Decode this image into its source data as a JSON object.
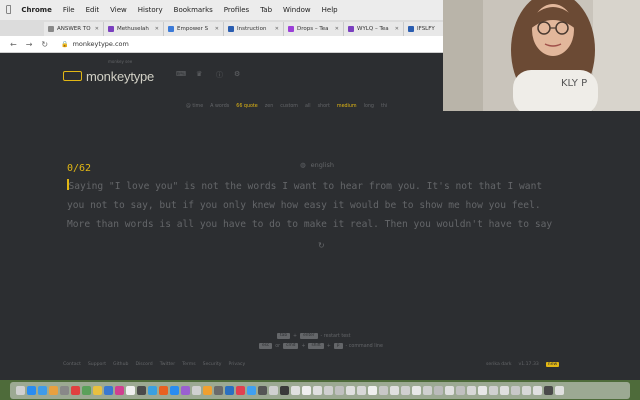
{
  "menubar": {
    "apple": "",
    "items": [
      "Chrome",
      "File",
      "Edit",
      "View",
      "History",
      "Bookmarks",
      "Profiles",
      "Tab",
      "Window",
      "Help"
    ]
  },
  "browser": {
    "tabs": [
      {
        "label": "ANSWER TO",
        "color": "#888888"
      },
      {
        "label": "Methuselah",
        "color": "#7a3fbf"
      },
      {
        "label": "Empower S",
        "color": "#3b7ad8"
      },
      {
        "label": "Instruction",
        "color": "#2a5db0"
      },
      {
        "label": "Drops – Tea",
        "color": "#9b3fd8"
      },
      {
        "label": "WYLQ – Tea",
        "color": "#7a3fbf"
      },
      {
        "label": "IFSLFY",
        "color": "#2a5db0"
      }
    ],
    "url": "monkeytype.com"
  },
  "app": {
    "logo_sub": "monkey see",
    "logo_title": "monkeytype",
    "mode_items": [
      {
        "label": "@ time",
        "active": false
      },
      {
        "label": "A words",
        "active": false
      },
      {
        "label": "66 quote",
        "active": true
      },
      {
        "label": "zen",
        "active": false
      },
      {
        "label": "custom",
        "active": false
      },
      {
        "label": "all",
        "active": false
      },
      {
        "label": "short",
        "active": false
      },
      {
        "label": "medium",
        "active": true
      },
      {
        "label": "long",
        "active": false
      },
      {
        "label": "thi",
        "active": false
      }
    ],
    "counter": "0/62",
    "language": "english",
    "first_char": "S",
    "text_lines": [
      "aying \"I love you\" is not the words I want to hear from you. It's not that I want",
      "you not to say, but if you only knew how easy it would be to show me how you feel.",
      "More than words is all you have to do to make it real. Then you wouldn't have to say"
    ],
    "hint1": {
      "key1": "tab",
      "plus": "+",
      "key2": "enter",
      "action": "- restart test"
    },
    "hint2": {
      "key1": "esc",
      "or": "or",
      "key2": "cmd",
      "plus1": "+",
      "key3": "shift",
      "plus2": "+",
      "key4": "p",
      "action": "- command line"
    },
    "footer_left": [
      "Contact",
      "Support",
      "Github",
      "Discord",
      "Twitter",
      "Terms",
      "Security",
      "Privacy"
    ],
    "footer_theme": "serika dark",
    "footer_version": "v1.17.33",
    "footer_badge": "new"
  },
  "colors": {
    "bg": "#2c2e31",
    "main": "#e2b714",
    "sub": "#646669",
    "text": "#d1d0c5"
  },
  "dock_icons": [
    "#d0d0d0",
    "#2a8cf0",
    "#3f9be8",
    "#e8a03f",
    "#888",
    "#e04040",
    "#5aa05a",
    "#e8c040",
    "#3a78d0",
    "#d04090",
    "#f0f0f0",
    "#4a4a4a",
    "#3aa0e0",
    "#e86020",
    "#2a8cf0",
    "#9a60d0",
    "#d0d0d0",
    "#f0a030",
    "#6a6a6a",
    "#2a70c0",
    "#e04050",
    "#40a0f0",
    "#555",
    "#d0d0d0",
    "#3a3a3a",
    "#e0e0e0",
    "#f0f0f0",
    "#e0e0e0",
    "#d0d0d0",
    "#c0c0c0",
    "#e0e0e0",
    "#d8d8d8",
    "#f0f0f0",
    "#c8c8c8",
    "#e0e0e0",
    "#d0d0d0",
    "#e8e8e8",
    "#d0d0d0",
    "#bbbbbb",
    "#e0e0e0",
    "#c0c0c0",
    "#d8d8d8",
    "#e8e8e8",
    "#d0d0d0",
    "#e0e0e0",
    "#c8c8c8",
    "#d8d8d8",
    "#e0e0e0",
    "#4a4a4a",
    "#e0e0e0"
  ]
}
